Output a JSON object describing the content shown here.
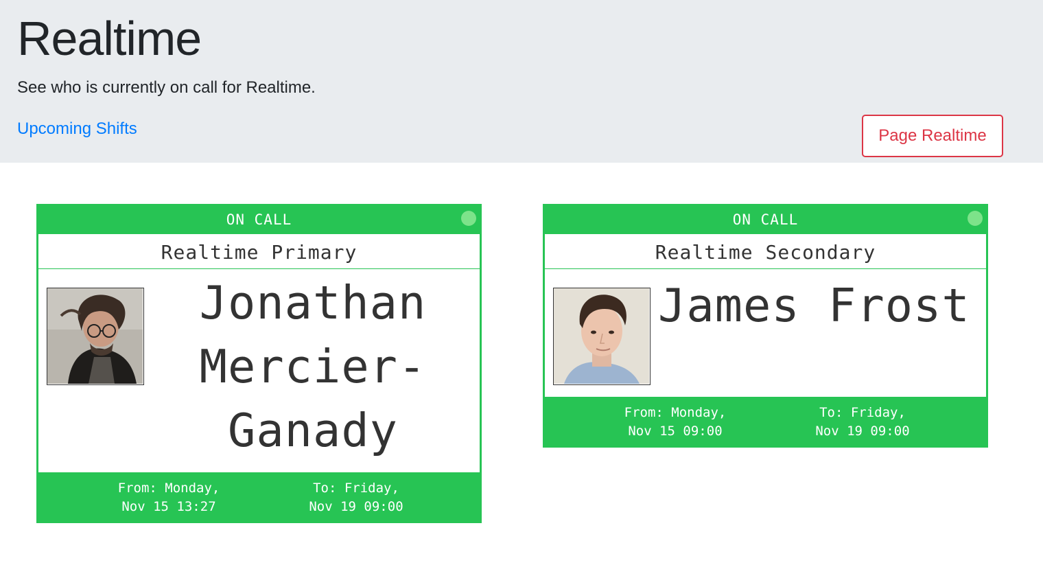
{
  "header": {
    "title": "Realtime",
    "subtitle": "See who is currently on call for Realtime.",
    "upcoming_link": "Upcoming Shifts",
    "page_button": "Page Realtime"
  },
  "cards": [
    {
      "status": "ON CALL",
      "rotation": "Realtime Primary",
      "name": "Jonathan Mercier-Ganady",
      "from": "From: Monday,\nNov 15 13:27",
      "to": "To: Friday,\nNov 19 09:00"
    },
    {
      "status": "ON CALL",
      "rotation": "Realtime Secondary",
      "name": "James Frost",
      "from": "From: Monday,\nNov 15 09:00",
      "to": "To: Friday,\nNov 19 09:00"
    }
  ],
  "colors": {
    "accent_green": "#27c454",
    "status_dot": "#7de38a",
    "link_blue": "#007bff",
    "danger_red": "#dc3545"
  }
}
